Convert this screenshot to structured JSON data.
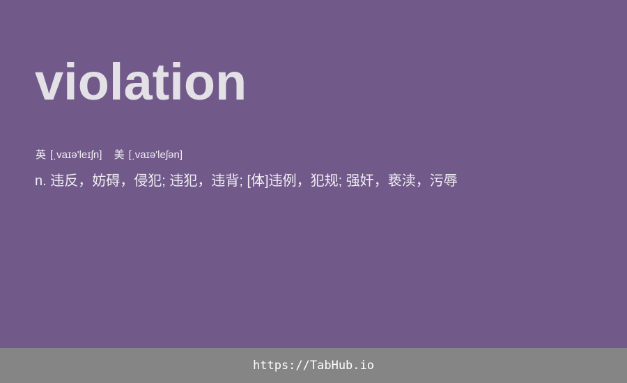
{
  "entry": {
    "word": "violation",
    "phonetics": {
      "uk_label": "英",
      "uk_ipa": "[ˌvaɪə'leɪʃn]",
      "us_label": "美",
      "us_ipa": "[ˌvaɪə'leʃən]"
    },
    "definition": "n. 违反，妨碍，侵犯; 违犯，违背; [体]违例，犯规; 强奸，亵渎，污辱"
  },
  "footer": {
    "link_text": "https://TabHub.io"
  },
  "colors": {
    "background": "#71598a",
    "footer_background": "#858585",
    "word_text": "#e3e1e6",
    "body_text": "#f0eef2"
  }
}
